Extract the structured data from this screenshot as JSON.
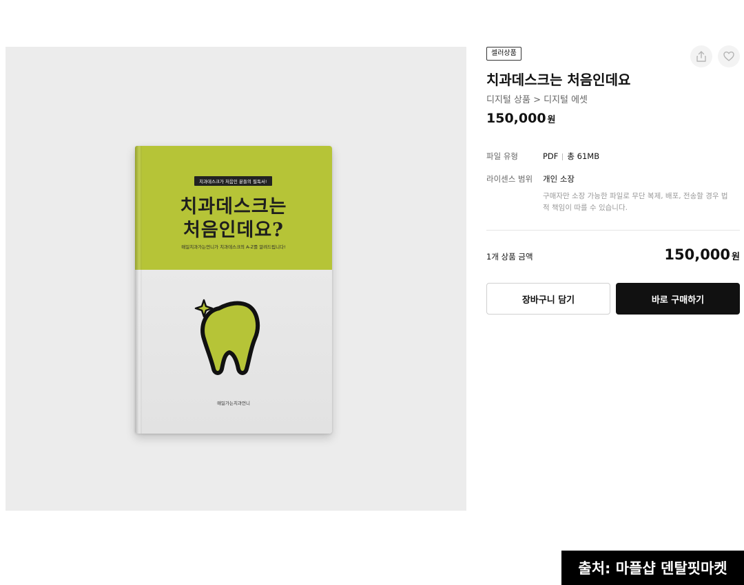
{
  "product_image": {
    "book": {
      "tagline": "치과데스크가 처음인 분들의 필독서!",
      "title_line1": "치과데스크는",
      "title_line2": "처음인데요?",
      "subtitle": "매일치과가는언니가 치과데스크의 A-Z를 알려드립니다!",
      "author": "매일가는치과언니"
    },
    "colors": {
      "cover_top": "#b6c437",
      "cover_bottom": "#e6e6e6"
    }
  },
  "product": {
    "badge": "셀러상품",
    "title": "치과데스크는 처음인데요",
    "breadcrumb": "디지털 상품 > 디지털 에셋",
    "price": "150,000",
    "price_unit": "원"
  },
  "actions": {
    "share_icon": "share-icon",
    "like_icon": "heart-icon"
  },
  "specs": {
    "file_type_label": "파일 유형",
    "file_type_value": "PDF",
    "file_size_value": "총 61MB",
    "license_label": "라이센스 범위",
    "license_value": "개인 소장",
    "license_note": "구매자만 소장 가능한 파일로 무단 복제, 배포, 전송할 경우 법적 책임이 따를 수 있습니다."
  },
  "summary": {
    "total_label": "1개 상품 금액",
    "total_price": "150,000",
    "total_unit": "원"
  },
  "buttons": {
    "cart": "장바구니 담기",
    "buy": "바로 구매하기"
  },
  "caption": "출처: 마플샵 덴탈핏마켓"
}
